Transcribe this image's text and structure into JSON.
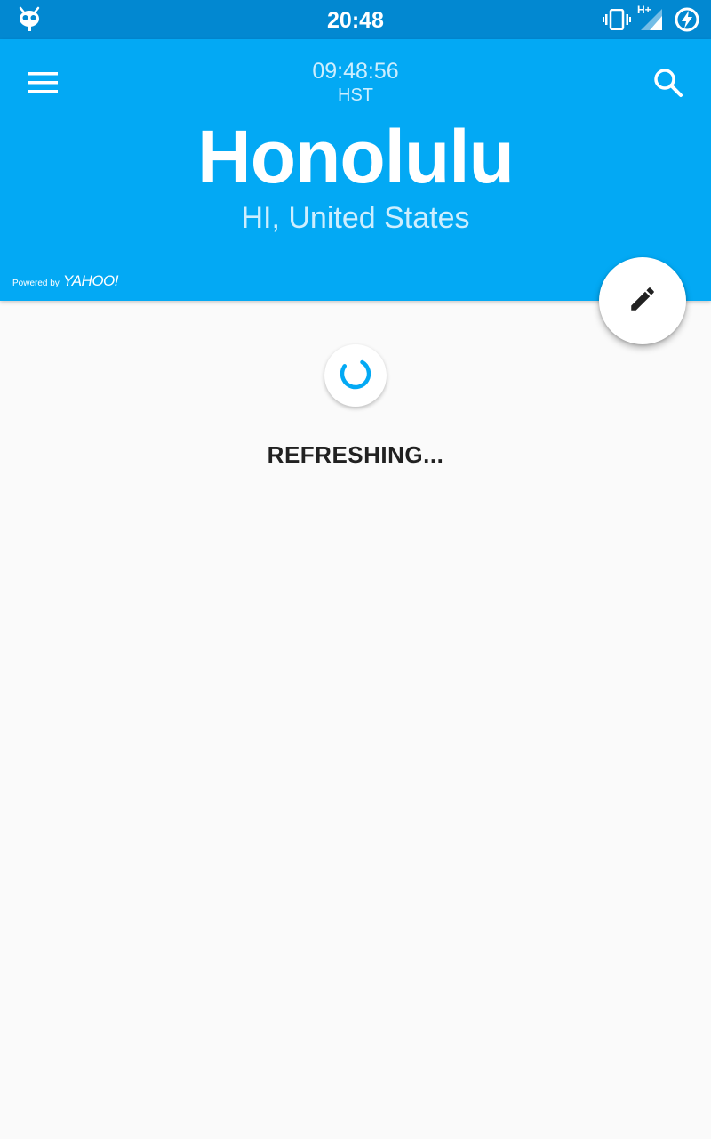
{
  "status_bar": {
    "time": "20:48",
    "network_label": "H+",
    "icons": [
      "cyanogenmod-icon",
      "vibrate-icon",
      "signal-icon",
      "battery-charging-icon"
    ]
  },
  "header": {
    "local_time": "09:48:56",
    "timezone": "HST",
    "city": "Honolulu",
    "region": "HI, United States",
    "powered_by_prefix": "Powered by",
    "powered_by_brand": "YAHOO!",
    "menu_icon": "menu-icon",
    "search_icon": "search-icon",
    "background_color": "#03a9f4",
    "status_bar_color": "#0288d1"
  },
  "fab": {
    "icon": "edit-pencil-icon"
  },
  "content": {
    "loading_text": "REFRESHING...",
    "spinner_color": "#03a9f4"
  }
}
